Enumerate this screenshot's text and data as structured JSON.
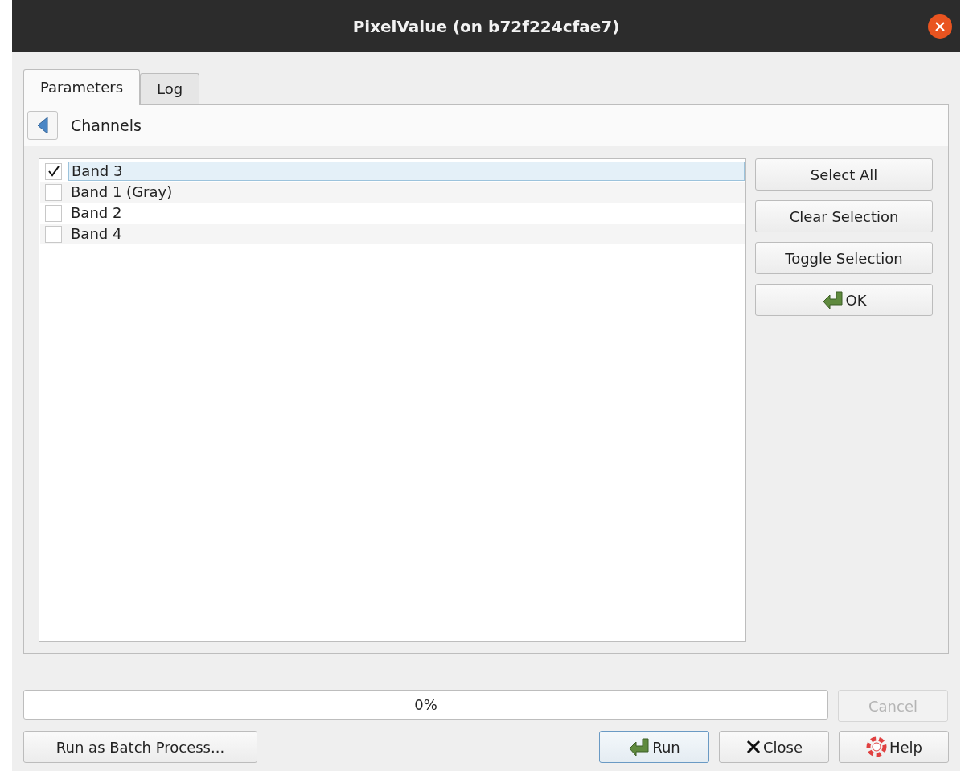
{
  "window": {
    "title": "PixelValue (on b72f224cfae7)"
  },
  "tabs": [
    {
      "label": "Parameters",
      "selected": true
    },
    {
      "label": "Log",
      "selected": false
    }
  ],
  "section": {
    "title": "Channels"
  },
  "channels": [
    {
      "label": "Band 3",
      "checked": true,
      "selected": true
    },
    {
      "label": "Band 1 (Gray)",
      "checked": false,
      "selected": false
    },
    {
      "label": "Band 2",
      "checked": false,
      "selected": false
    },
    {
      "label": "Band 4",
      "checked": false,
      "selected": false
    }
  ],
  "side_buttons": [
    {
      "label": "Select All",
      "kind": "plain"
    },
    {
      "label": "Clear Selection",
      "kind": "plain"
    },
    {
      "label": "Toggle Selection",
      "kind": "plain"
    },
    {
      "label": "OK",
      "kind": "apply"
    }
  ],
  "progress": {
    "reading": "0%"
  },
  "cancel_button": {
    "label": "Cancel",
    "disabled": true
  },
  "batch_button": {
    "label": "Run as Batch Process..."
  },
  "bottom_buttons": [
    {
      "label": "Run",
      "kind": "run",
      "focused": true
    },
    {
      "label": "Close",
      "kind": "close",
      "focused": false
    },
    {
      "label": "Help",
      "kind": "help",
      "focused": false
    }
  ]
}
